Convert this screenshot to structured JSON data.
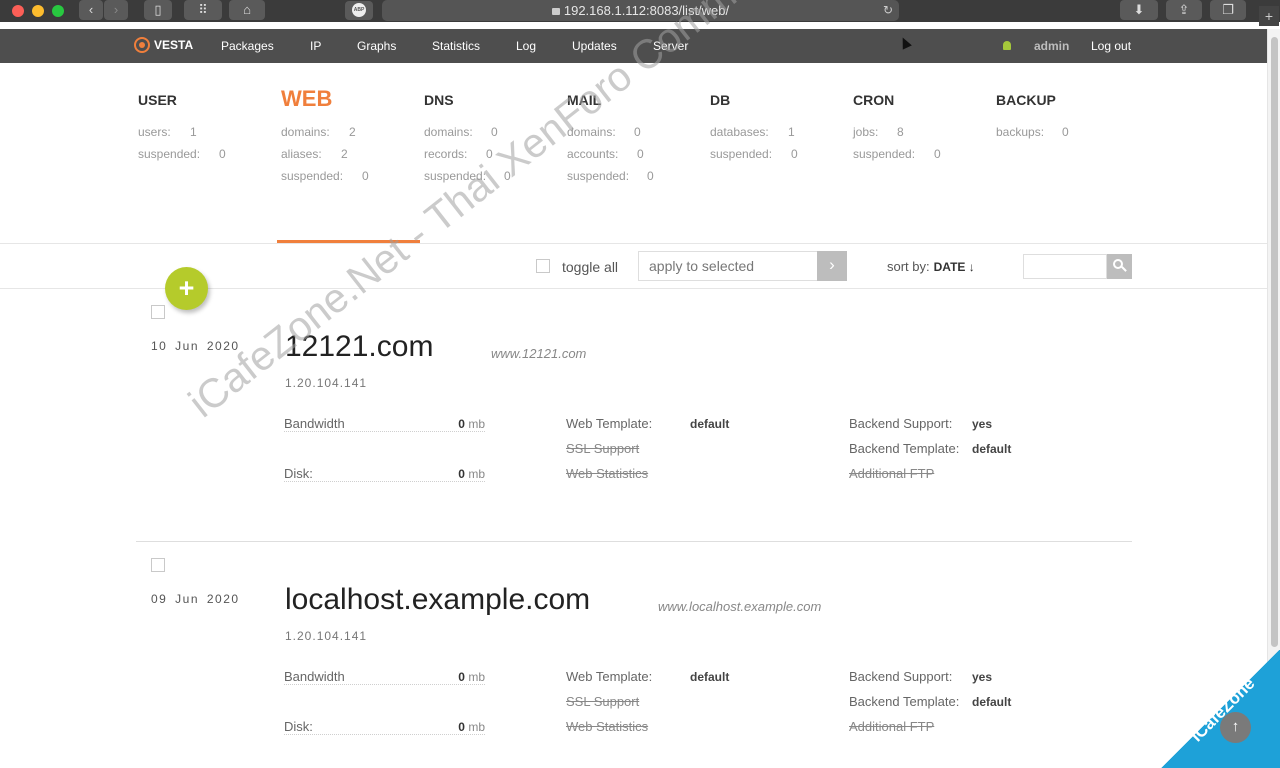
{
  "browser": {
    "url": "192.168.1.112:8083/list/web/",
    "traffic_lights": [
      "#fc5f57",
      "#fdbc2e",
      "#28c840"
    ]
  },
  "nav": {
    "logo": "VESTA",
    "items": [
      "Packages",
      "IP",
      "Graphs",
      "Statistics",
      "Log",
      "Updates",
      "Server"
    ],
    "user": "admin",
    "logout": "Log out"
  },
  "stats": [
    {
      "title": "USER",
      "rows": [
        {
          "k": "users:",
          "v": "1"
        },
        {
          "k": "suspended:",
          "v": "0"
        }
      ]
    },
    {
      "title": "WEB",
      "rows": [
        {
          "k": "domains:",
          "v": "2"
        },
        {
          "k": "aliases:",
          "v": "2"
        },
        {
          "k": "suspended:",
          "v": "0"
        }
      ]
    },
    {
      "title": "DNS",
      "rows": [
        {
          "k": "domains:",
          "v": "0"
        },
        {
          "k": "records:",
          "v": "0"
        },
        {
          "k": "suspended:",
          "v": "0"
        }
      ]
    },
    {
      "title": "MAIL",
      "rows": [
        {
          "k": "domains:",
          "v": "0"
        },
        {
          "k": "accounts:",
          "v": "0"
        },
        {
          "k": "suspended:",
          "v": "0"
        }
      ]
    },
    {
      "title": "DB",
      "rows": [
        {
          "k": "databases:",
          "v": "1"
        },
        {
          "k": "suspended:",
          "v": "0"
        }
      ]
    },
    {
      "title": "CRON",
      "rows": [
        {
          "k": "jobs:",
          "v": "8"
        },
        {
          "k": "suspended:",
          "v": "0"
        }
      ]
    },
    {
      "title": "BACKUP",
      "rows": [
        {
          "k": "backups:",
          "v": "0"
        }
      ]
    }
  ],
  "toolbar": {
    "toggle_all": "toggle all",
    "apply_placeholder": "apply to selected",
    "sort_label": "sort by:",
    "sort_value": "DATE ↓"
  },
  "domains": [
    {
      "date": "10 Jun 2020",
      "name": "12121.com",
      "alias": "www.12121.com",
      "ip": "1.20.104.141",
      "bandwidth_label": "Bandwidth",
      "bandwidth": "0",
      "bandwidth_unit": "mb",
      "disk_label": "Disk:",
      "disk": "0",
      "disk_unit": "mb",
      "web_template_label": "Web Template:",
      "web_template": "default",
      "ssl_label": "SSL Support",
      "webstats_label": "Web Statistics",
      "backend_support_label": "Backend Support:",
      "backend_support": "yes",
      "backend_template_label": "Backend Template:",
      "backend_template": "default",
      "ftp_label": "Additional FTP"
    },
    {
      "date": "09 Jun 2020",
      "name": "localhost.example.com",
      "alias": "www.localhost.example.com",
      "ip": "1.20.104.141",
      "bandwidth_label": "Bandwidth",
      "bandwidth": "0",
      "bandwidth_unit": "mb",
      "disk_label": "Disk:",
      "disk": "0",
      "disk_unit": "mb",
      "web_template_label": "Web Template:",
      "web_template": "default",
      "ssl_label": "SSL Support",
      "webstats_label": "Web Statistics",
      "backend_support_label": "Backend Support:",
      "backend_support": "yes",
      "backend_template_label": "Backend Template:",
      "backend_template": "default",
      "ftp_label": "Additional FTP"
    }
  ],
  "watermark": "iCafeZone.Net - Thai XenForo Community",
  "corner_watermark": "iCafeZone"
}
